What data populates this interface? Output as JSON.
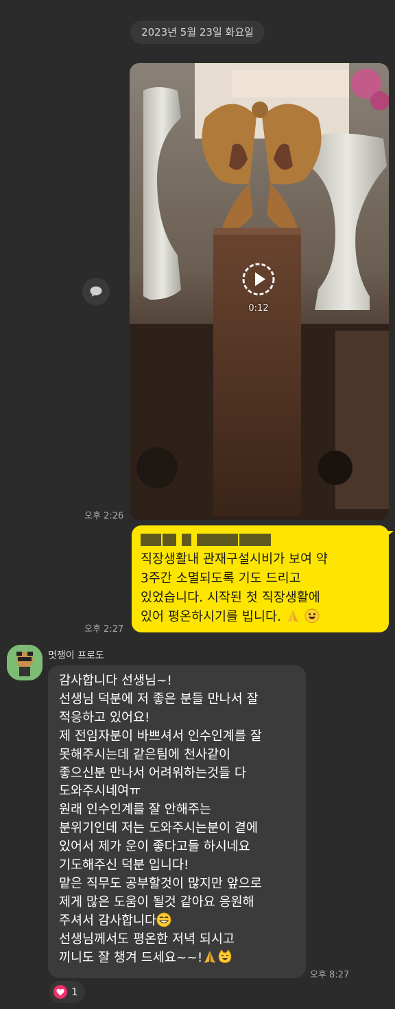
{
  "date_divider": "2023년 5월 23일 화요일",
  "video": {
    "duration": "0:12",
    "time": "오후 2:26"
  },
  "outgoing_message": {
    "blurred_first_line": "○○○님 잘 지내시는지요?",
    "lines": [
      "직장생활내 관재구설시비가 보여 약",
      "3주간 소멸되도록 기도 드리고",
      "있었습니다. 시작된 첫 직장생활에",
      "있어 평온하시기를 빕니다."
    ],
    "time": "오후 2:27"
  },
  "incoming_message": {
    "sender": "멋쟁이 프로도",
    "lines": [
      "감사합니다 선생님~!",
      "선생님 덕분에 저 좋은 분들 만나서 잘",
      "적응하고 있어요!",
      "제 전임자분이 바쁘셔서 인수인계를 잘",
      "못해주시는데 같은팀에 천사같이",
      "좋으신분 만나서 어려워하는것들 다",
      "도와주시네여ㅠ",
      "원래 인수인계를 잘 안해주는",
      "분위기인데 저는 도와주시는분이 곁에",
      "있어서 제가 운이 좋다고들 하시네요",
      "기도해주신 덕분 입니다!",
      "맡은 직무도 공부할것이 많지만 앞으로",
      "제게 많은 도움이 될것 같아요 응원해",
      "주셔서 감사합니다",
      "선생님께서도 평온한 저녁 되시고",
      "끼니도 잘 챙겨 드세요~~!"
    ],
    "time": "오후 8:27"
  },
  "reaction": {
    "icon": "heart-icon",
    "count": "1"
  },
  "colors": {
    "background": "#2b2b2b",
    "outgoing_bubble": "#fee500",
    "incoming_bubble": "#3b3b3b",
    "reaction_heart": "#f0306a"
  }
}
